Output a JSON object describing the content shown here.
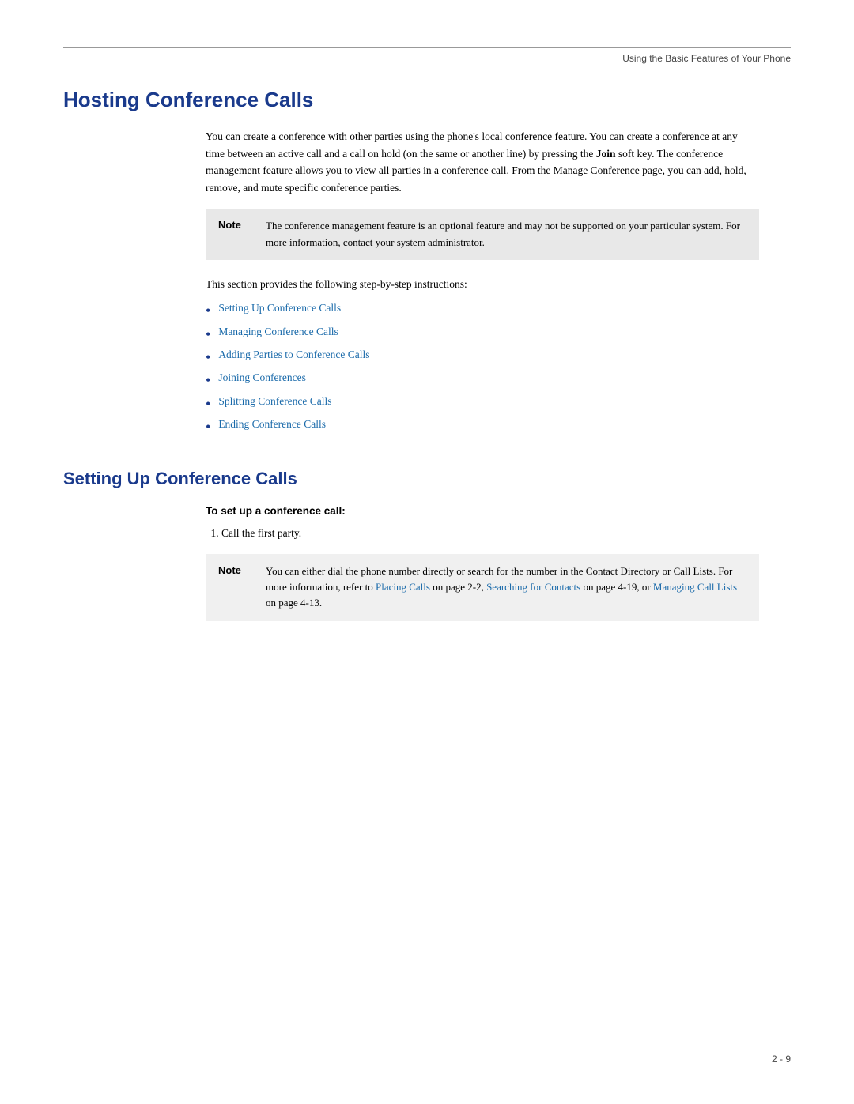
{
  "header": {
    "rule": true,
    "text": "Using the Basic Features of Your Phone"
  },
  "main_title": "Hosting Conference Calls",
  "intro_paragraph": "You can create a conference with other parties using the phone's local conference feature. You can create a conference at any time between an active call and a call on hold (on the same or another line) by pressing the Join soft key. The conference management feature allows you to view all parties in a conference call. From the Manage Conference page, you can add, hold, remove, and mute specific conference parties.",
  "note1": {
    "label": "Note",
    "text": "The conference management feature is an optional feature and may not be supported on your particular system. For more information, contact your system administrator."
  },
  "section_intro": "This section provides the following step-by-step instructions:",
  "bullet_links": [
    "Setting Up Conference Calls",
    "Managing Conference Calls",
    "Adding Parties to Conference Calls",
    "Joining Conferences",
    "Splitting Conference Calls",
    "Ending Conference Calls"
  ],
  "section2_title": "Setting Up Conference Calls",
  "subsection_label": "To set up a conference call:",
  "step1": "Call the first party.",
  "note2": {
    "label": "Note",
    "text_prefix": "You can either dial the phone number directly or search for the number in the Contact Directory or Call Lists. For more information, refer to ",
    "link1_text": "Placing Calls",
    "text_mid1": " on page 2-2, ",
    "link2_text": "Searching for Contacts",
    "text_mid2": " on page 4-19, or ",
    "link3_text": "Managing Call Lists",
    "text_suffix": " on page 4-13."
  },
  "footer": {
    "page": "2 - 9"
  }
}
